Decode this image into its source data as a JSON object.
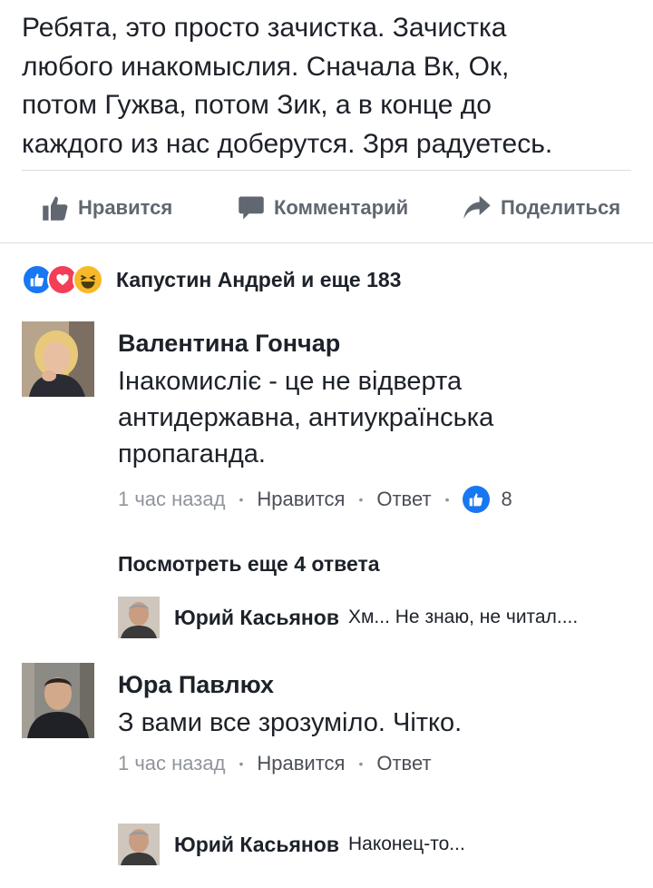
{
  "post": {
    "text_lines": [
      "Ребята, это просто зачистка. Зачистка",
      "любого инакомыслия. Сначала Вк, Ок,",
      "потом Гужва, потом Зик, а в конце до",
      "каждого из нас доберутся. Зря радуетесь."
    ]
  },
  "actions": {
    "like_label": "Нравится",
    "comment_label": "Комментарий",
    "share_label": "Поделиться"
  },
  "reactions": {
    "icons": [
      "like-icon",
      "love-icon",
      "haha-icon"
    ],
    "summary": "Капустин Андрей и еще 183"
  },
  "comments": [
    {
      "author": "Валентина Гончар",
      "text_lines": [
        "Інакомисліє - це не відверта",
        "антидержавна, антиукраїнська",
        "пропаганда."
      ],
      "time": "1 час назад",
      "like_label": "Нравится",
      "reply_label": "Ответ",
      "like_count": "8",
      "more_replies": "Посмотреть еще 4 ответа",
      "reply_preview": {
        "author": "Юрий Касьянов",
        "text": "Хм... Не знаю, не читал...."
      }
    },
    {
      "author": "Юра Павлюх",
      "text_lines": [
        "З вами все зрозуміло. Чітко."
      ],
      "time": "1 час назад",
      "like_label": "Нравится",
      "reply_label": "Ответ",
      "reply_preview": {
        "author": "Юрий Касьянов",
        "text": "Наконец-то..."
      }
    }
  ],
  "colors": {
    "text": "#1d2129",
    "secondary": "#90949c",
    "action": "#606770",
    "like_blue": "#1877f2",
    "love_red": "#f33e58",
    "haha_yellow": "#f7b928",
    "divider": "#dadde1"
  }
}
